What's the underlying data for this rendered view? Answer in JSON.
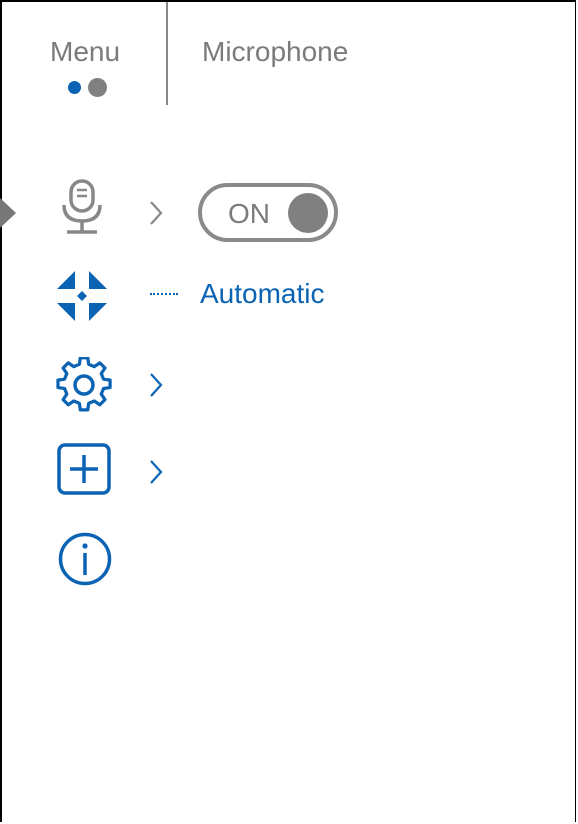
{
  "header": {
    "menu_label": "Menu",
    "title": "Microphone",
    "page_indicator": {
      "total": 2,
      "active": 1
    }
  },
  "menu_items": [
    {
      "icon": "microphone-icon",
      "has_submenu": true,
      "selected": true,
      "control": {
        "type": "toggle",
        "label": "ON",
        "value": true
      }
    },
    {
      "icon": "calibration-icon",
      "value": "Automatic"
    },
    {
      "icon": "gear-icon",
      "has_submenu": true
    },
    {
      "icon": "add-square-icon",
      "has_submenu": true
    },
    {
      "icon": "info-icon",
      "has_submenu": false
    }
  ],
  "colors": {
    "accent": "#0a63b3",
    "gray": "#808080",
    "text_gray": "#7b7b7b"
  }
}
